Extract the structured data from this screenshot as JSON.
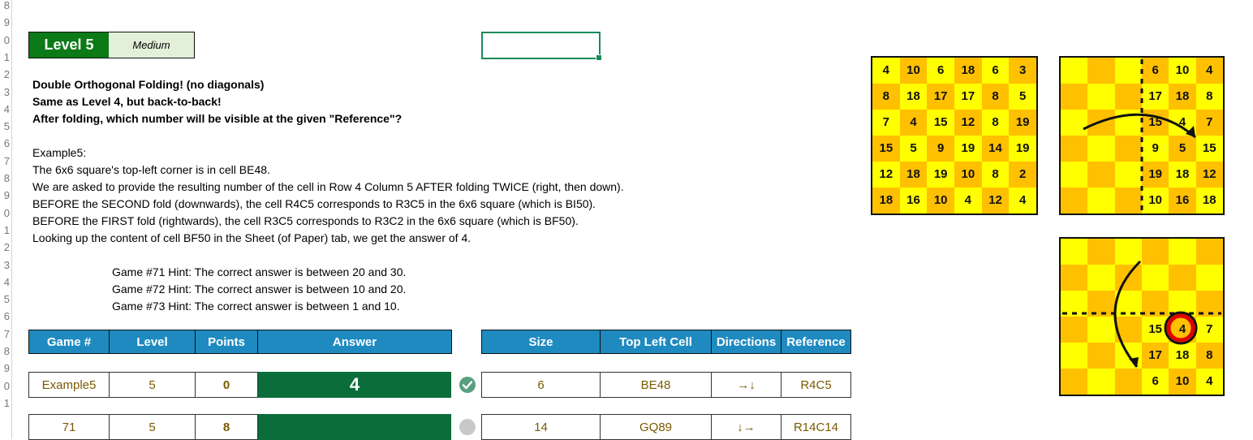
{
  "row_numbers": [
    "8",
    "9",
    "0",
    "1",
    "2",
    "3",
    "4",
    "5",
    "6",
    "7",
    "8",
    "9",
    "0",
    "1",
    "2",
    "3",
    "4",
    "5",
    "6",
    "7",
    "8",
    "9",
    "0",
    "1"
  ],
  "level_badge": "Level 5",
  "difficulty_badge": "Medium",
  "instructions": {
    "line1": "Double Orthogonal Folding! (no diagonals)",
    "line2": "Same as Level 4, but back-to-back!",
    "line3": "After folding, which number will be visible at the given \"Reference\"?"
  },
  "example": {
    "title": "Example5:",
    "lines": [
      "The 6x6 square's top-left corner is in cell BE48.",
      "We are asked to provide the resulting number of the cell in Row 4 Column 5 AFTER folding TWICE (right, then down).",
      "BEFORE the SECOND fold (downwards), the cell R4C5 corresponds to R3C5 in the 6x6 square (which is BI50).",
      "BEFORE the FIRST fold (rightwards), the cell R3C5 corresponds to R3C2 in the 6x6 square (which is BF50).",
      "Looking up the content of cell BF50 in the Sheet (of Paper) tab, we get the answer of 4."
    ]
  },
  "hints": [
    "Game #71 Hint: The correct answer is between 20 and 30.",
    "Game #72 Hint: The correct answer is between 10 and 20.",
    "Game #73 Hint: The correct answer is between 1 and 10."
  ],
  "table_left": {
    "headers": [
      "Game #",
      "Level",
      "Points",
      "Answer"
    ],
    "rows": [
      {
        "game": "Example5",
        "level": "5",
        "points": "0",
        "answer": "4"
      },
      {
        "game": "71",
        "level": "5",
        "points": "8",
        "answer": ""
      }
    ]
  },
  "table_right": {
    "headers": [
      "Size",
      "Top Left Cell",
      "Directions",
      "Reference"
    ],
    "rows": [
      {
        "size": "6",
        "top_left": "BE48",
        "directions": "→↓",
        "reference": "R4C5"
      },
      {
        "size": "14",
        "top_left": "GQ89",
        "directions": "↓→",
        "reference": "R14C14"
      }
    ]
  },
  "status_colors": {
    "correct": "#5a9e80",
    "pending": "#c8c8c8"
  },
  "board1": {
    "rows": [
      [
        "4",
        "10",
        "6",
        "18",
        "6",
        "3"
      ],
      [
        "8",
        "18",
        "17",
        "17",
        "8",
        "5"
      ],
      [
        "7",
        "4",
        "15",
        "12",
        "8",
        "19"
      ],
      [
        "15",
        "5",
        "9",
        "19",
        "14",
        "19"
      ],
      [
        "12",
        "18",
        "19",
        "10",
        "8",
        "2"
      ],
      [
        "18",
        "16",
        "10",
        "4",
        "12",
        "4"
      ]
    ]
  },
  "board2": {
    "rows": [
      [
        "6",
        "10",
        "4"
      ],
      [
        "17",
        "18",
        "8"
      ],
      [
        "15",
        "4",
        "7"
      ],
      [
        "9",
        "5",
        "15"
      ],
      [
        "19",
        "18",
        "12"
      ],
      [
        "10",
        "16",
        "18"
      ]
    ]
  },
  "board3": {
    "rows": [
      [
        "15",
        "4",
        "7"
      ],
      [
        "17",
        "18",
        "8"
      ],
      [
        "6",
        "10",
        "4"
      ]
    ]
  },
  "colors": {
    "yellow": "#ffff00",
    "orange": "#ffc000",
    "green": "#0b7a17"
  }
}
